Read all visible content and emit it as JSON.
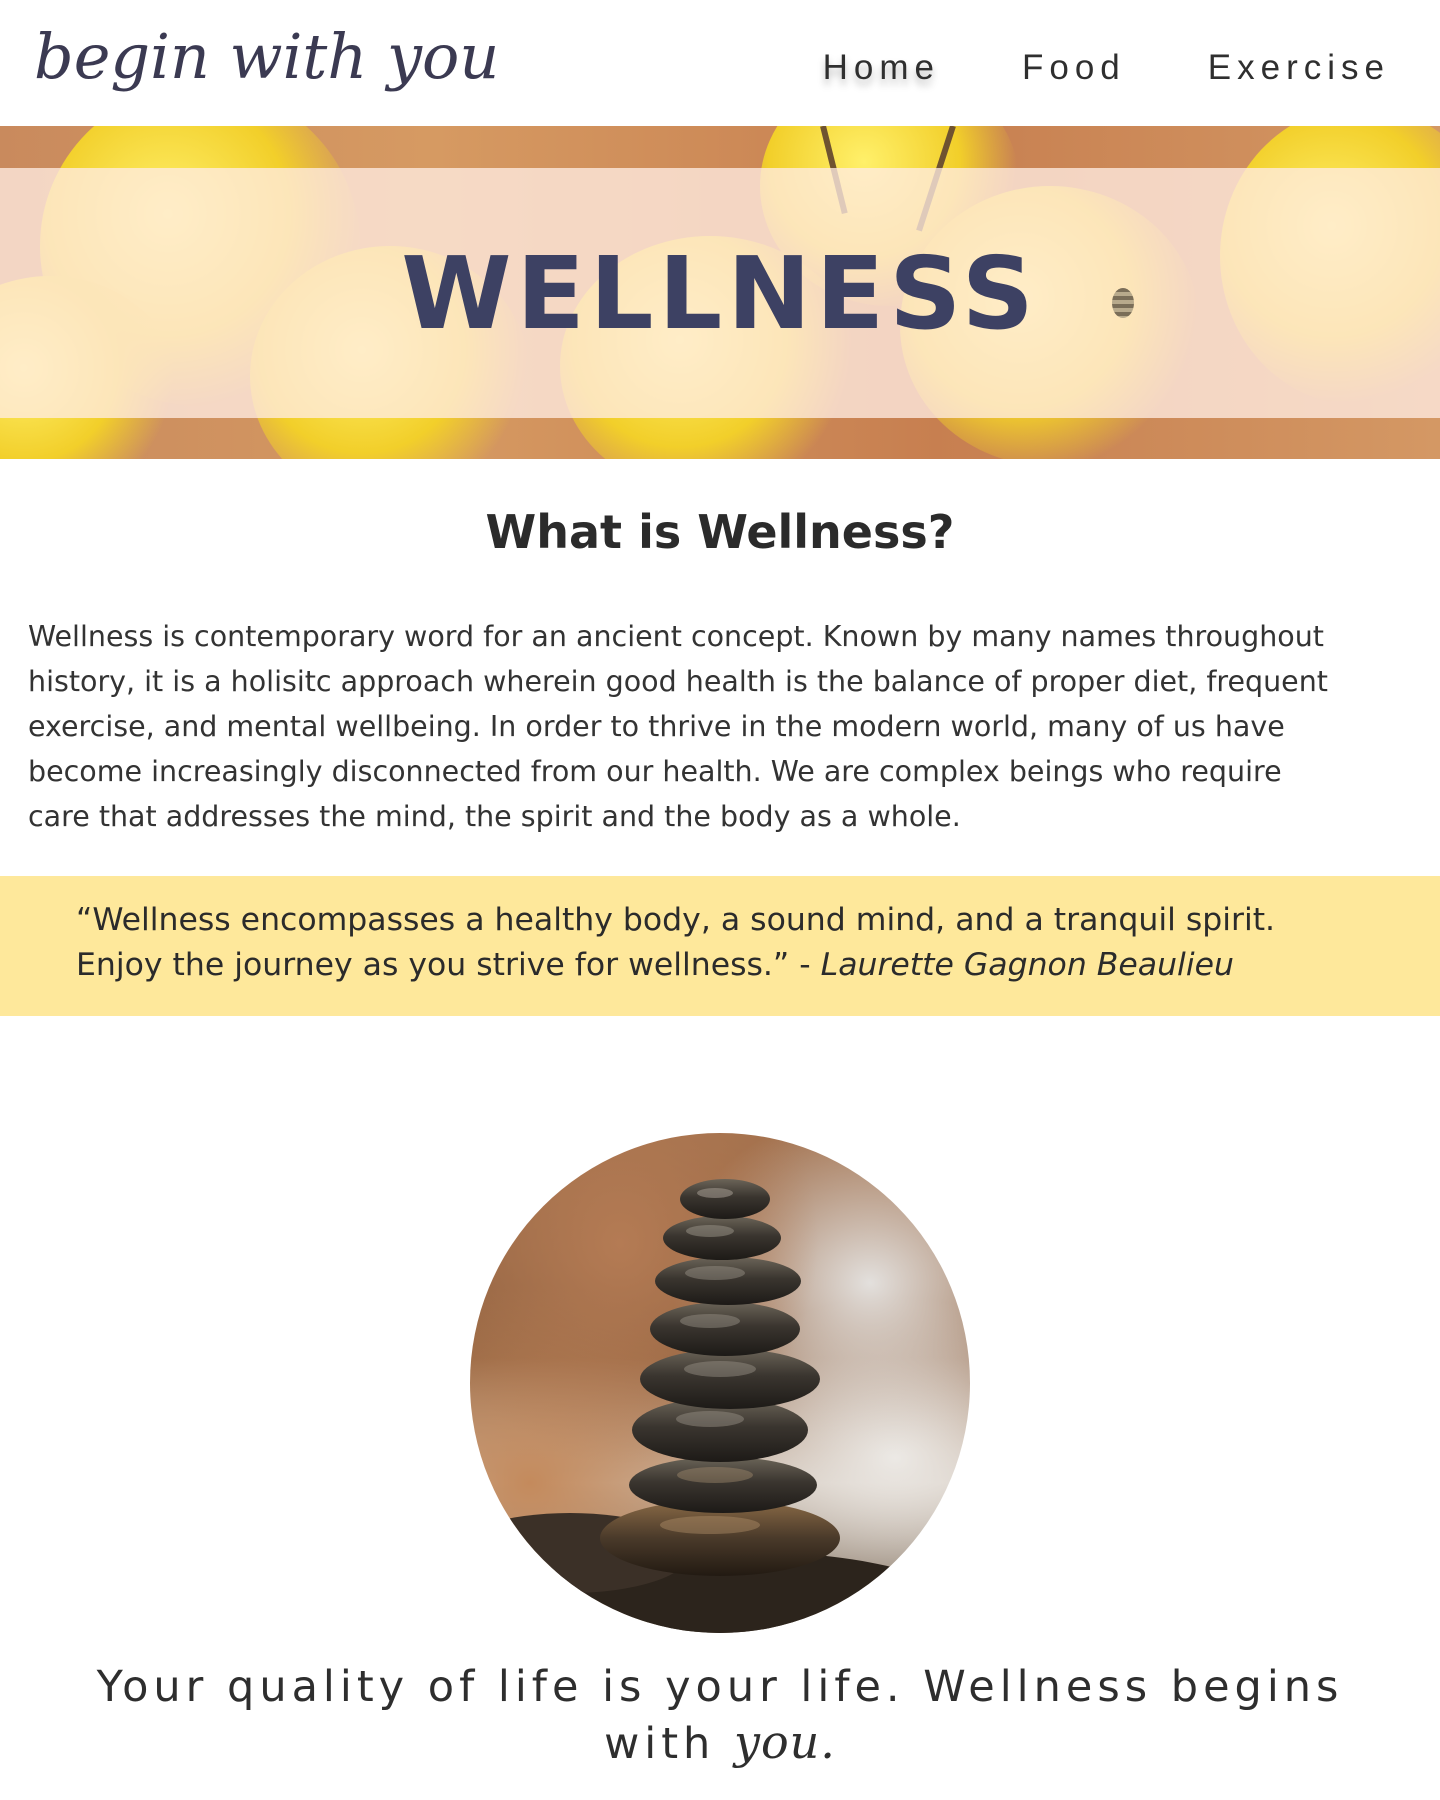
{
  "header": {
    "logo_text": "begin with you",
    "nav": [
      {
        "label": "Home",
        "active": true
      },
      {
        "label": "Food",
        "active": false
      },
      {
        "label": "Exercise",
        "active": false
      }
    ]
  },
  "hero": {
    "title": "WELLNESS"
  },
  "intro": {
    "heading": "What is Wellness?",
    "lines": [
      "Wellness is contemporary word for an ancient concept. Known by many names throughout",
      "history, it is a holisitc approach wherein good health is the balance of proper diet, frequent",
      "exercise, and mental wellbeing. In order to thrive in the modern world, many of us have",
      "become increasingly disconnected from our health. We are complex beings who require",
      "care that addresses the mind, the spirit and the body as a whole."
    ]
  },
  "quote": {
    "line1": "“Wellness encompasses a healthy body, a sound mind, and a tranquil spirit.",
    "line2": "Enjoy the journey as you strive for wellness.”",
    "separator": " - ",
    "author": "Laurette Gagnon Beaulieu"
  },
  "tagline": {
    "line1": "Your quality of life is your life. Wellness begins",
    "line2_start": "with ",
    "line2_script": "you."
  },
  "colors": {
    "quote_band": "#fee89b",
    "hero_title": "#3d4163",
    "logo": "#3b3a52"
  },
  "icons": {
    "hero_image": "yellow-flowers-photo",
    "circle_image": "stacked-stones-photo"
  }
}
